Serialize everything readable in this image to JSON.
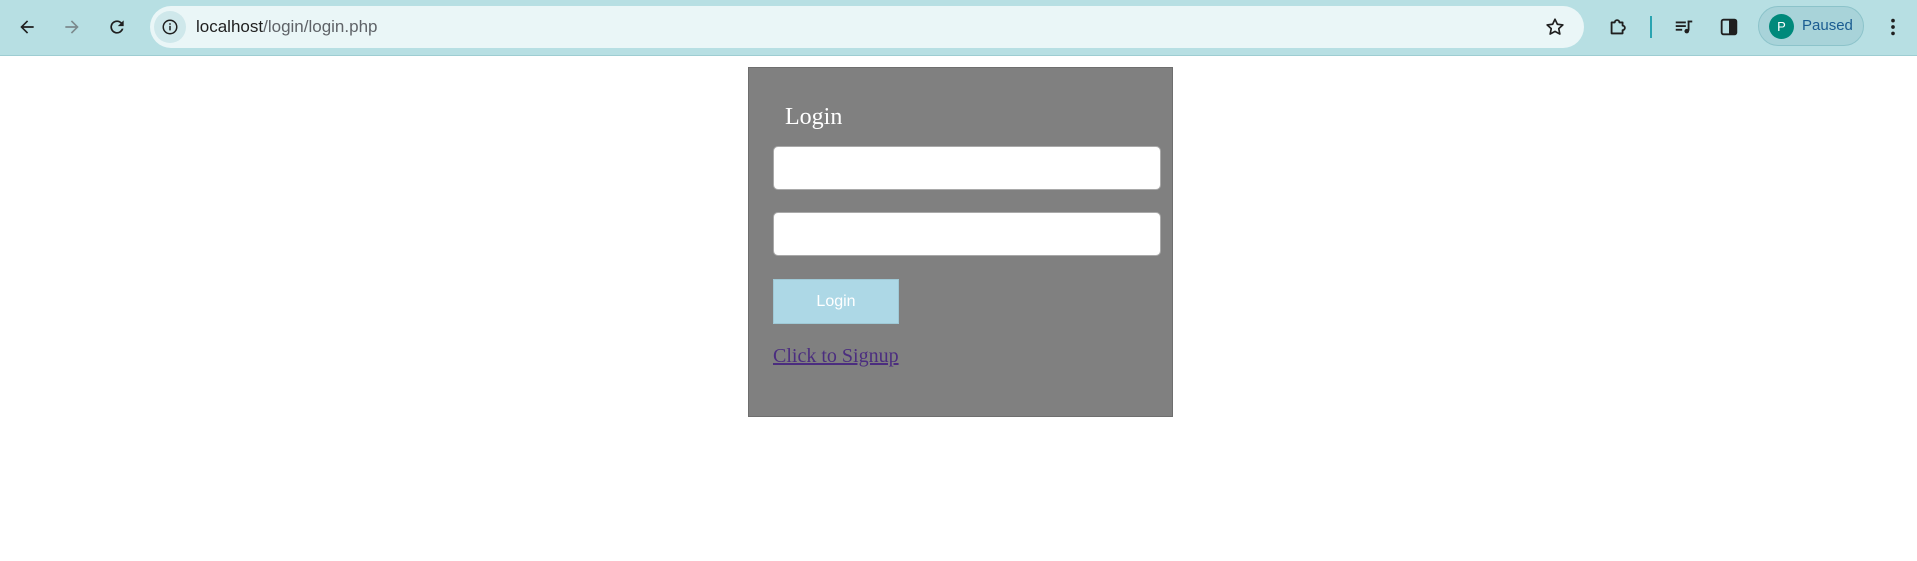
{
  "browser": {
    "url_host": "localhost",
    "url_path": "/login/login.php",
    "profile_initial": "P",
    "profile_status": "Paused",
    "icons": {
      "back": "arrow-left-icon",
      "forward": "arrow-right-icon",
      "reload": "reload-icon",
      "site_info": "info-icon",
      "bookmark": "star-icon",
      "extensions": "puzzle-icon",
      "media": "queue-music-icon",
      "side_panel": "side-panel-icon",
      "menu": "kebab-menu-icon"
    },
    "colors": {
      "toolbar": "#b7dfe3",
      "omnibox": "#eaf6f7",
      "avatar": "#00897b"
    }
  },
  "login": {
    "title": "Login",
    "username_value": "",
    "password_value": "",
    "button_label": "Login",
    "signup_link": "Click to Signup",
    "colors": {
      "card": "#808080",
      "button": "#add8e6",
      "link": "#4b2d7f"
    }
  }
}
